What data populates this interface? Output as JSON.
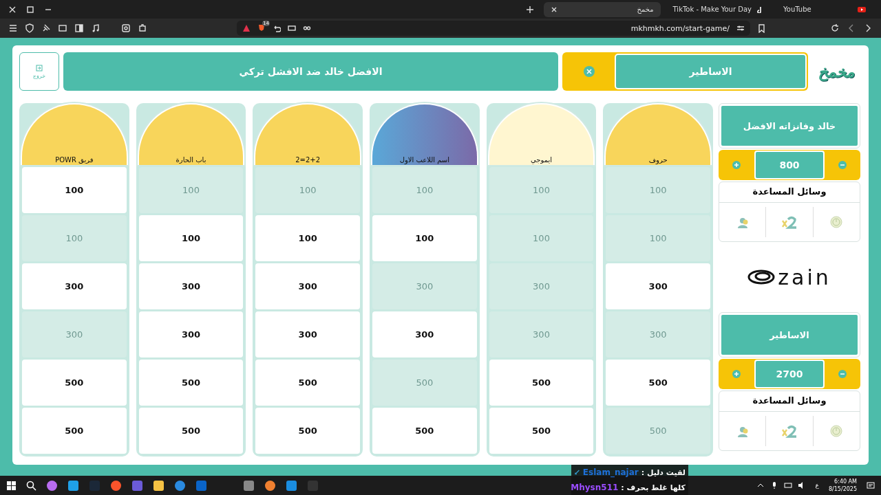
{
  "browser": {
    "tabs": [
      {
        "title": "مخمخ",
        "selected": true
      },
      {
        "title": "TikTok - Make Your Day",
        "selected": false
      },
      {
        "title": "YouTube",
        "selected": false
      }
    ],
    "badge": "14",
    "url": "mkhmkh.com/start-game/"
  },
  "header": {
    "logo": "مخمخ",
    "current_team": "الاساطير",
    "match_title": "الافضل خالد ضد الافشل تركي",
    "exit_label": "خروج"
  },
  "board": {
    "categories": [
      {
        "name": "حروف",
        "cells": [
          {
            "value": "100",
            "used": true
          },
          {
            "value": "100",
            "used": true
          },
          {
            "value": "300",
            "used": false
          },
          {
            "value": "300",
            "used": true
          },
          {
            "value": "500",
            "used": false
          },
          {
            "value": "500",
            "used": true
          }
        ]
      },
      {
        "name": "ايموجي",
        "cells": [
          {
            "value": "100",
            "used": true
          },
          {
            "value": "100",
            "used": true
          },
          {
            "value": "300",
            "used": true
          },
          {
            "value": "300",
            "used": true
          },
          {
            "value": "500",
            "used": false
          },
          {
            "value": "500",
            "used": false
          }
        ]
      },
      {
        "name": "اسم اللاعب الاول",
        "cells": [
          {
            "value": "100",
            "used": true
          },
          {
            "value": "100",
            "used": false
          },
          {
            "value": "300",
            "used": true
          },
          {
            "value": "300",
            "used": false
          },
          {
            "value": "500",
            "used": true
          },
          {
            "value": "500",
            "used": false
          }
        ]
      },
      {
        "name": "2=2+2",
        "cells": [
          {
            "value": "100",
            "used": true
          },
          {
            "value": "100",
            "used": false
          },
          {
            "value": "300",
            "used": false
          },
          {
            "value": "300",
            "used": false
          },
          {
            "value": "500",
            "used": false
          },
          {
            "value": "500",
            "used": false
          }
        ]
      },
      {
        "name": "باب الحارة",
        "cells": [
          {
            "value": "100",
            "used": true
          },
          {
            "value": "100",
            "used": false
          },
          {
            "value": "300",
            "used": false
          },
          {
            "value": "300",
            "used": false
          },
          {
            "value": "500",
            "used": false
          },
          {
            "value": "500",
            "used": false
          }
        ]
      },
      {
        "name": "فريق POWR",
        "cells": [
          {
            "value": "100",
            "used": false
          },
          {
            "value": "100",
            "used": true
          },
          {
            "value": "300",
            "used": false
          },
          {
            "value": "300",
            "used": true
          },
          {
            "value": "500",
            "used": false
          },
          {
            "value": "500",
            "used": false
          }
        ]
      }
    ]
  },
  "teams": [
    {
      "name": "خالد وفانزاته الافضل",
      "score": "800",
      "help_title": "وسائل المساعدة"
    },
    {
      "name": "الاساطير",
      "score": "2700",
      "help_title": "وسائل المساعدة"
    }
  ],
  "sponsor": "zain",
  "chat": [
    {
      "message": "لقيت دليل :",
      "user": "Eslam_najar",
      "color": "#1e6fd9"
    },
    {
      "message": "كلها غلط بحرف :",
      "user": "Mhysn511",
      "color": "#9b4dff"
    }
  ],
  "taskbar": {
    "language": "ع",
    "time": "6:40 AM",
    "date": "8/15/2025"
  }
}
